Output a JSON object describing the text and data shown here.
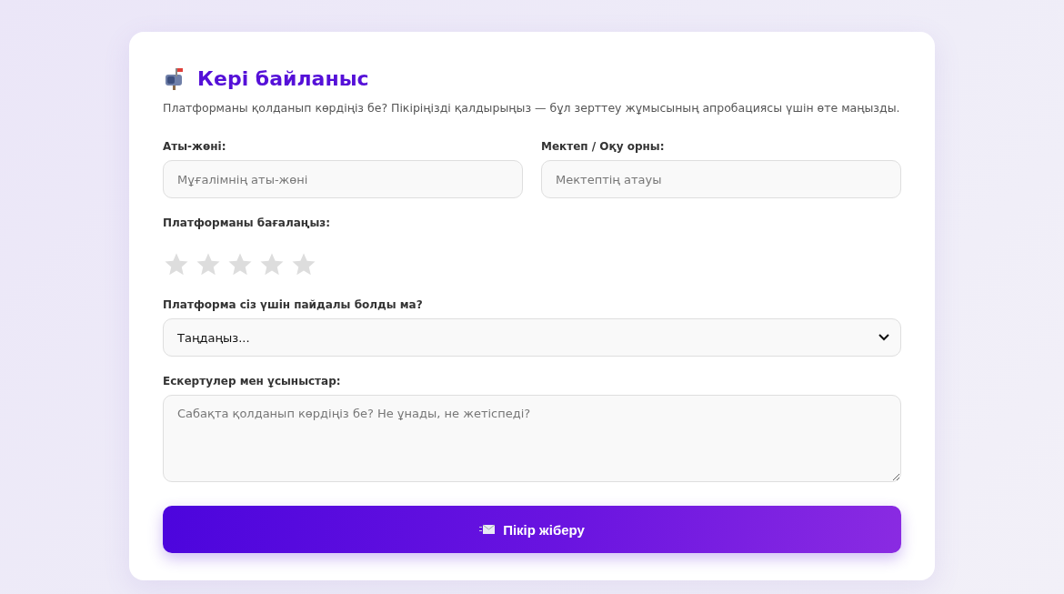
{
  "title": "Кері байланыс",
  "subtitle": "Платформаны қолданып көрдіңіз бе? Пікіріңізді қалдырыңыз — бұл зерттеу жұмысының апробациясы үшін өте маңызды.",
  "name_field": {
    "label": "Аты-жөні:",
    "placeholder": "Мұғалімнің аты-жөні"
  },
  "school_field": {
    "label": "Мектеп / Оқу орны:",
    "placeholder": "Мектептің атауы"
  },
  "rating": {
    "label": "Платформаны бағалаңыз:",
    "stars": 0
  },
  "useful": {
    "label": "Платформа сіз үшін пайдалы болды ма?",
    "value": "Таңдаңыз..."
  },
  "comments": {
    "label": "Ескертулер мен ұсыныстар:",
    "placeholder": "Сабақта қолданып көрдіңіз бе? Не ұнады, не жетіспеді?"
  },
  "submit": {
    "label": "Пікір жіберу"
  }
}
